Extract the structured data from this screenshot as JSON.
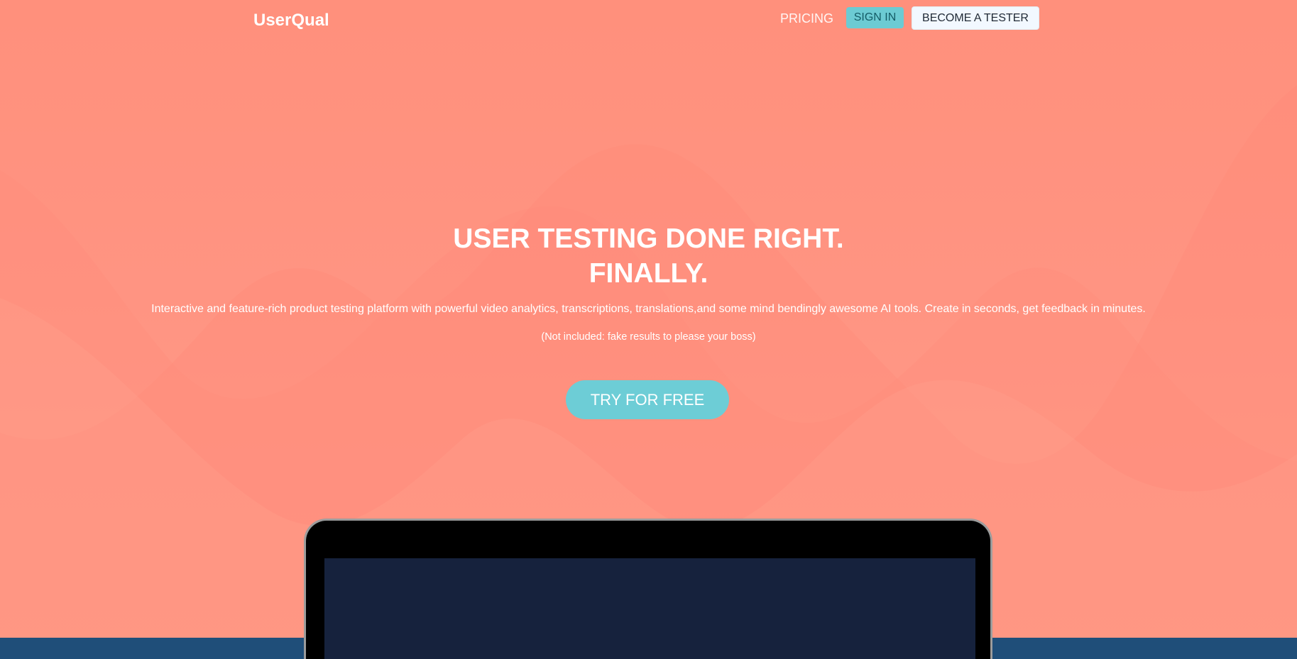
{
  "nav": {
    "logo": "UserQual",
    "pricing": "PRICING",
    "sign_in": "SIGN IN",
    "become_tester": "BECOME A TESTER"
  },
  "hero": {
    "title_line1": "USER TESTING DONE RIGHT.",
    "title_line2": "FINALLY.",
    "description": "Interactive and feature-rich product testing platform with powerful video analytics, transcriptions, translations,and some mind bendingly awesome AI tools. Create in seconds, get feedback in minutes.",
    "note": "(Not included: fake results to please your boss)",
    "cta": "TRY FOR FREE"
  },
  "colors": {
    "background": "#ff947f",
    "accent_teal": "#6dcdd6",
    "bottom_band": "#1f4e79",
    "laptop_screen": "#16223d"
  }
}
